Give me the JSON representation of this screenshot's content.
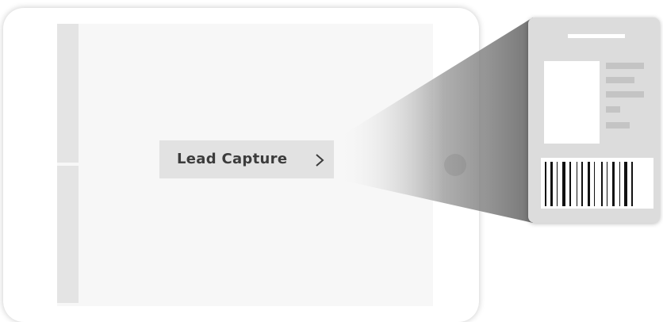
{
  "lead_capture_button": {
    "label": "Lead Capture",
    "chevron_icon": "chevron-right-icon"
  },
  "badge": {
    "barcode_icon": "barcode-icon",
    "photo_icon": "photo-placeholder"
  },
  "colors": {
    "screen_background": "#f7f7f7",
    "sidebar": "#e4e4e4",
    "button_background": "#e2e2e2",
    "button_text": "#3c3c3c",
    "badge_background": "#dcdcdc",
    "beam": "#888888"
  }
}
